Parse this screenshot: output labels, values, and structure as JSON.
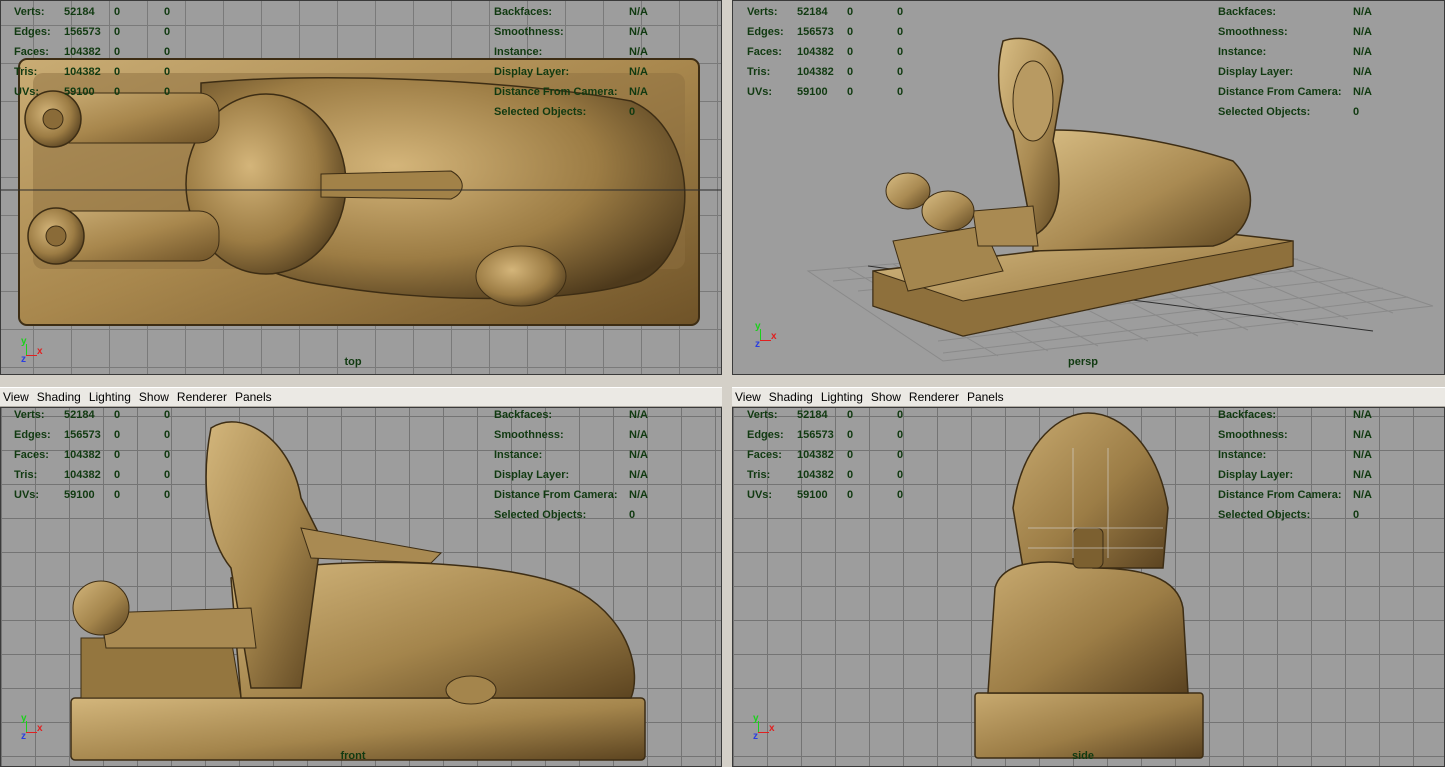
{
  "menu": [
    "View",
    "Shading",
    "Lighting",
    "Show",
    "Renderer",
    "Panels"
  ],
  "hud_left": [
    {
      "label": "Verts:",
      "v1": "52184",
      "v2": "0",
      "v3": "0"
    },
    {
      "label": "Edges:",
      "v1": "156573",
      "v2": "0",
      "v3": "0"
    },
    {
      "label": "Faces:",
      "v1": "104382",
      "v2": "0",
      "v3": "0"
    },
    {
      "label": "Tris:",
      "v1": "104382",
      "v2": "0",
      "v3": "0"
    },
    {
      "label": "UVs:",
      "v1": "59100",
      "v2": "0",
      "v3": "0"
    }
  ],
  "hud_right": [
    {
      "label": "Backfaces:",
      "value": "N/A"
    },
    {
      "label": "Smoothness:",
      "value": "N/A"
    },
    {
      "label": "Instance:",
      "value": "N/A"
    },
    {
      "label": "Display Layer:",
      "value": "N/A"
    },
    {
      "label": "Distance From Camera:",
      "value": "N/A"
    },
    {
      "label": "Selected Objects:",
      "value": "0"
    }
  ],
  "viewports": {
    "top": {
      "camera": "top"
    },
    "persp": {
      "camera": "persp"
    },
    "front": {
      "camera": "front"
    },
    "side": {
      "camera": "side"
    }
  },
  "axis": {
    "y": "y",
    "x": "x",
    "z": "z"
  },
  "colors": {
    "viewport_bg": "#9d9d9d",
    "grid_line": "#7a7a7a",
    "hud_text": "#113a11",
    "stone": "#a98a52",
    "stone_dark": "#5a4424",
    "menubar_bg": "#ebe9e4"
  }
}
